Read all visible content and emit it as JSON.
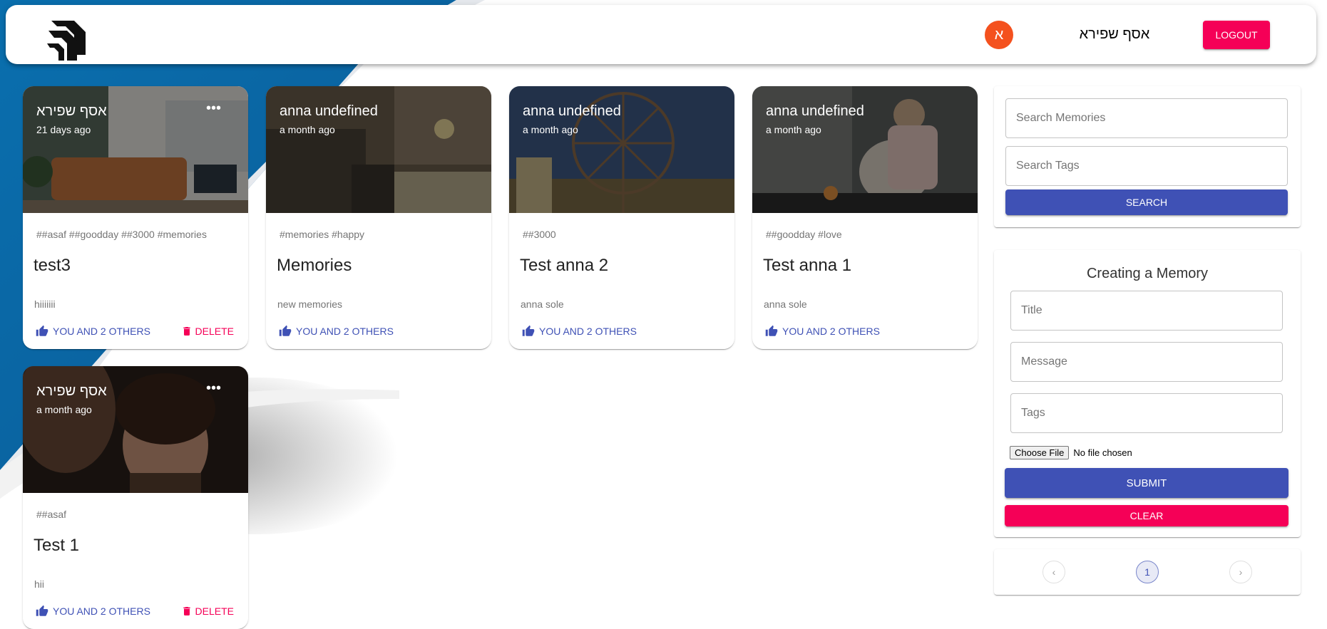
{
  "header": {
    "avatar_letter": "א",
    "username": "אסף שפירא",
    "logout_label": "LOGOUT"
  },
  "posts": [
    {
      "author": "אסף שפירא",
      "time": "21 days ago",
      "tags": "##asaf ##goodday ##3000 #memories",
      "title": "test3",
      "message": "hiiiiiii",
      "likes": "YOU AND 2 OTHERS",
      "delete": "DELETE"
    },
    {
      "author": "anna undefined",
      "time": "a month ago",
      "tags": "#memories #happy",
      "title": "Memories",
      "message": "new memories",
      "likes": "YOU AND 2 OTHERS"
    },
    {
      "author": "anna undefined",
      "time": "a month ago",
      "tags": "##3000",
      "title": "Test anna 2",
      "message": "anna sole",
      "likes": "YOU AND 2 OTHERS"
    },
    {
      "author": "anna undefined",
      "time": "a month ago",
      "tags": "##goodday #love",
      "title": "Test anna 1",
      "message": "anna sole",
      "likes": "YOU AND 2 OTHERS"
    },
    {
      "author": "אסף שפירא",
      "time": "a month ago",
      "tags": "##asaf",
      "title": "Test 1",
      "message": "hii",
      "likes": "YOU AND 2 OTHERS",
      "delete": "DELETE"
    }
  ],
  "search": {
    "memories_placeholder": "Search Memories",
    "tags_placeholder": "Search Tags",
    "button_label": "SEARCH"
  },
  "form": {
    "heading": "Creating a Memory",
    "title_placeholder": "Title",
    "message_placeholder": "Message",
    "tags_placeholder": "Tags",
    "choose_file_label": "Choose File",
    "no_file_label": "No file chosen",
    "submit_label": "SUBMIT",
    "clear_label": "CLEAR"
  },
  "pagination": {
    "prev_icon": "‹",
    "current_page": "1",
    "next_icon": "›"
  },
  "colors": {
    "primary": "#3f51b5",
    "secondary": "#f50057",
    "avatar": "#f4511e"
  }
}
